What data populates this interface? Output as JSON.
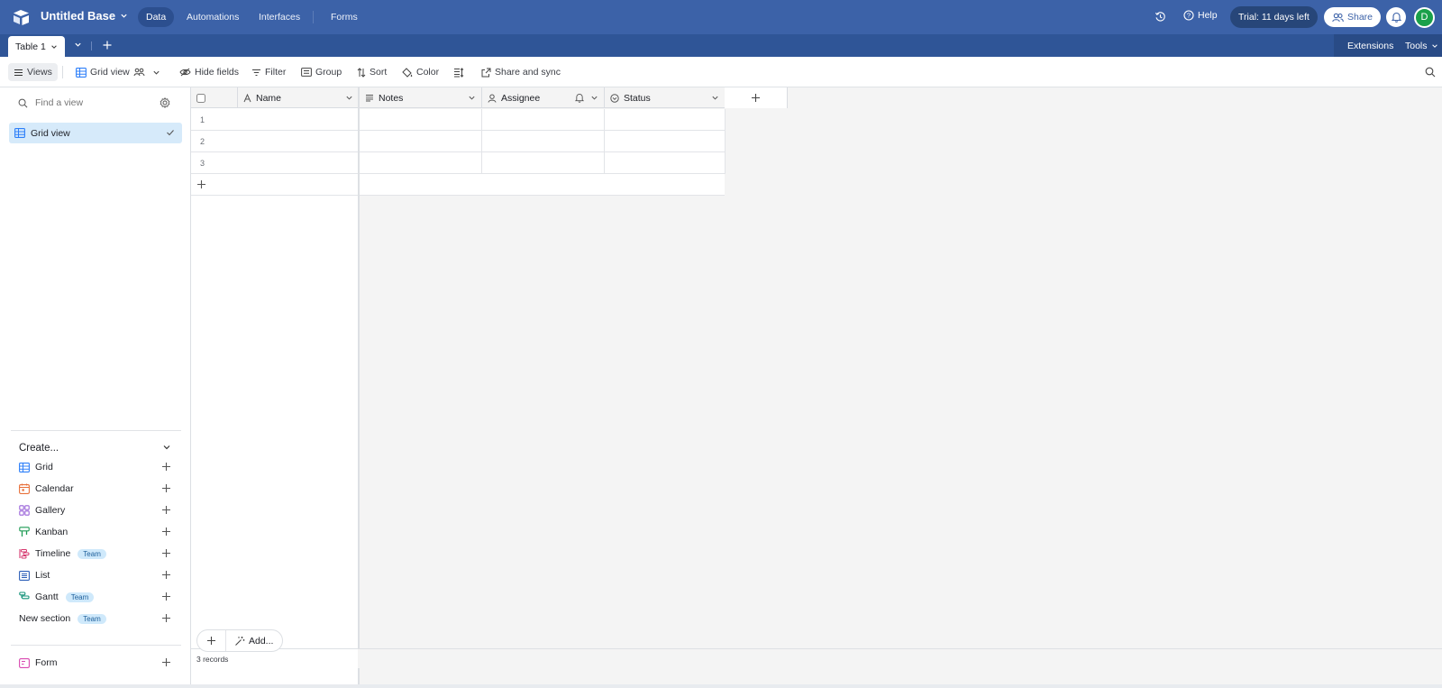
{
  "app": {
    "base_name": "Untitled Base",
    "nav": [
      "Data",
      "Automations",
      "Interfaces",
      "Forms"
    ],
    "help_label": "Help",
    "trial_label": "Trial: 11 days left",
    "share_label": "Share",
    "avatar_initial": "D",
    "brand_color": "#3c62a8"
  },
  "tabs": {
    "active_table": "Table 1",
    "extensions_label": "Extensions",
    "tools_label": "Tools"
  },
  "toolbar": {
    "views_label": "Views",
    "current_view": "Grid view",
    "hide_fields": "Hide fields",
    "filter": "Filter",
    "group": "Group",
    "sort": "Sort",
    "color": "Color",
    "share_sync": "Share and sync"
  },
  "sidebar": {
    "find_placeholder": "Find a view",
    "selected_view": "Grid view",
    "create_header": "Create...",
    "create_items": [
      {
        "label": "Grid",
        "icon": "grid-icon",
        "badge": ""
      },
      {
        "label": "Calendar",
        "icon": "calendar-icon",
        "badge": ""
      },
      {
        "label": "Gallery",
        "icon": "gallery-icon",
        "badge": ""
      },
      {
        "label": "Kanban",
        "icon": "kanban-icon",
        "badge": ""
      },
      {
        "label": "Timeline",
        "icon": "timeline-icon",
        "badge": "Team"
      },
      {
        "label": "List",
        "icon": "list-icon",
        "badge": ""
      },
      {
        "label": "Gantt",
        "icon": "gantt-icon",
        "badge": "Team"
      },
      {
        "label": "New section",
        "icon": "",
        "badge": "Team"
      }
    ],
    "form_label": "Form"
  },
  "grid": {
    "columns": [
      {
        "label": "Name",
        "icon": "text-field-icon"
      },
      {
        "label": "Notes",
        "icon": "long-text-icon"
      },
      {
        "label": "Assignee",
        "icon": "user-field-icon"
      },
      {
        "label": "Status",
        "icon": "single-select-icon"
      }
    ],
    "rows": [
      {
        "num": "1",
        "cells": [
          "",
          "",
          "",
          ""
        ]
      },
      {
        "num": "2",
        "cells": [
          "",
          "",
          "",
          ""
        ]
      },
      {
        "num": "3",
        "cells": [
          "",
          "",
          "",
          ""
        ]
      }
    ],
    "add_label": "Add...",
    "record_count": "3 records"
  }
}
